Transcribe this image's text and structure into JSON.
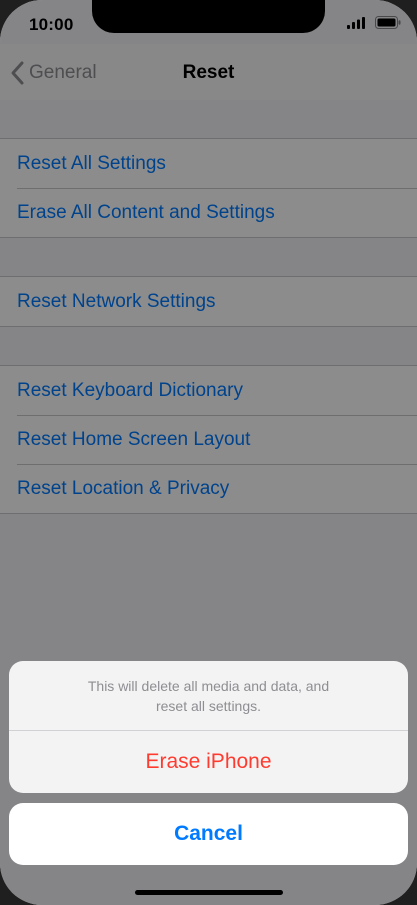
{
  "status_bar": {
    "time": "10:00",
    "icons": [
      "signal-icon",
      "battery-icon"
    ]
  },
  "nav": {
    "back_label": "General",
    "title": "Reset"
  },
  "settings": {
    "groups": [
      {
        "items": [
          {
            "label": "Reset All Settings"
          },
          {
            "label": "Erase All Content and Settings"
          }
        ]
      },
      {
        "items": [
          {
            "label": "Reset Network Settings"
          }
        ]
      },
      {
        "items": [
          {
            "label": "Reset Keyboard Dictionary"
          },
          {
            "label": "Reset Home Screen Layout"
          },
          {
            "label": "Reset Location & Privacy"
          }
        ]
      }
    ]
  },
  "action_sheet": {
    "message": "This will delete all media and data, and reset all settings.",
    "destructive_label": "Erase iPhone",
    "cancel_label": "Cancel"
  },
  "colors": {
    "link_blue": "#007aff",
    "destructive_red": "#ff3b30",
    "secondary_gray": "#8e8e93"
  }
}
